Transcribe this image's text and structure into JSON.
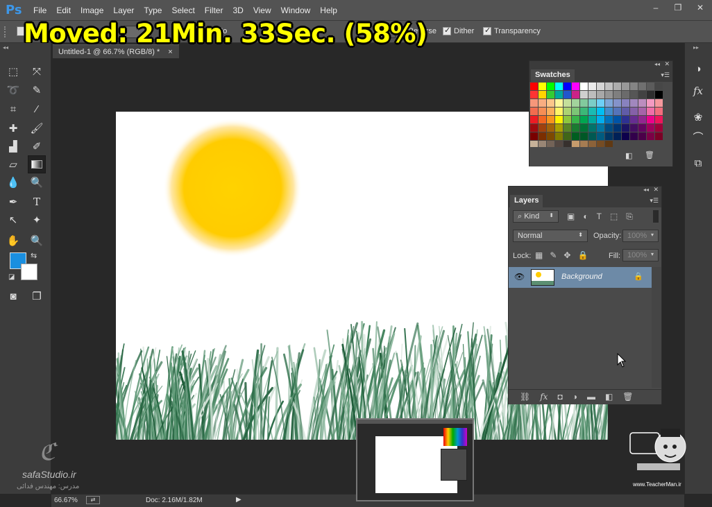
{
  "app": {
    "logo": "Ps"
  },
  "menu": [
    "File",
    "Edit",
    "Image",
    "Layer",
    "Type",
    "Select",
    "Filter",
    "3D",
    "View",
    "Window",
    "Help"
  ],
  "window_controls": [
    "–",
    "❐",
    "✕"
  ],
  "overlay": {
    "text": "Moved: 21Min. 33Sec. (58%)",
    "color": "#ffff00"
  },
  "options": {
    "mode_prefix": "Mo",
    "opacity_prefix": "O",
    "reverse": "Reverse",
    "dither": "Dither",
    "transparency": "Transparency"
  },
  "document": {
    "tab_title": "Untitled-1 @ 66.7% (RGB/8) *",
    "close": "×"
  },
  "colors": {
    "foreground": "#1a8fe0",
    "background": "#ffffff",
    "sun": "#ffd000",
    "grass": "#2e6e4a",
    "selection": "#6d8aa7"
  },
  "swatches_panel": {
    "title": "Swatches"
  },
  "layers_panel": {
    "title": "Layers",
    "filter_kind": "Kind",
    "blend_mode": "Normal",
    "opacity_label": "Opacity:",
    "opacity_value": "100%",
    "lock_label": "Lock:",
    "fill_label": "Fill:",
    "fill_value": "100%",
    "layers": [
      {
        "name": "Background",
        "visible": true,
        "locked": true
      }
    ]
  },
  "status": {
    "zoom": "66.67%",
    "doc": "Doc: 2.16M/1.82M"
  },
  "watermark": {
    "site": "safaStudio.ir",
    "teacher": "مدرس: مهندس فدائی",
    "teacherman": "www.TeacherMan.ir"
  }
}
